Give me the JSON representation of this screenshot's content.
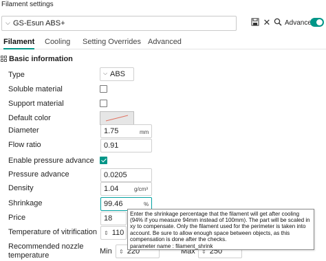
{
  "window": {
    "title": "Filament settings"
  },
  "toolbar": {
    "preset": "GS-Esun ABS+",
    "advanced_label": "Advanced",
    "advanced_on": true,
    "icons": [
      "save-icon",
      "close-icon",
      "search-icon"
    ]
  },
  "tabs": [
    {
      "label": "Filament",
      "active": true
    },
    {
      "label": "Cooling",
      "active": false
    },
    {
      "label": "Setting Overrides",
      "active": false
    },
    {
      "label": "Advanced",
      "active": false
    }
  ],
  "section": {
    "title": "Basic information"
  },
  "fields": {
    "type": {
      "label": "Type",
      "value": "ABS"
    },
    "soluble": {
      "label": "Soluble material",
      "checked": false
    },
    "support": {
      "label": "Support material",
      "checked": false
    },
    "color": {
      "label": "Default color",
      "value": "#e07060"
    },
    "diameter": {
      "label": "Diameter",
      "value": "1.75",
      "unit": "mm"
    },
    "flow": {
      "label": "Flow ratio",
      "value": "0.91"
    },
    "enable_pa": {
      "label": "Enable pressure advance",
      "checked": true
    },
    "pa": {
      "label": "Pressure advance",
      "value": "0.0205"
    },
    "density": {
      "label": "Density",
      "value": "1.04",
      "unit": "g/cm³"
    },
    "shrinkage": {
      "label": "Shrinkage",
      "value": "99.46",
      "unit": "%"
    },
    "price": {
      "label": "Price",
      "value": "18"
    },
    "vitrification": {
      "label": "Temperature of vitrification",
      "value": "110"
    },
    "nozzle": {
      "label_line1": "Recommended nozzle",
      "label_line2": "temperature",
      "min_label": "Min",
      "min_value": "220",
      "max_label": "Max",
      "max_value": "250"
    }
  },
  "tooltip": {
    "text": "Enter the shrinkage percentage that the filament will get after cooling (94% if you measure 94mm instead of 100mm). The part will be scaled in xy to compensate. Only the filament used for the perimeter is taken into account. Be sure to allow enough space between objects, as this compensation is done after the checks.",
    "param": "parameter name   : filament_shrink"
  },
  "colors": {
    "accent": "#009688"
  }
}
